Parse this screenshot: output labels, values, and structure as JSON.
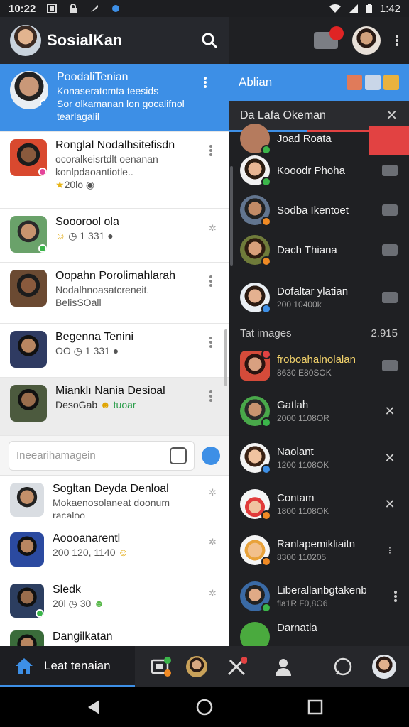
{
  "status": {
    "time": "10:22",
    "right_time": "1:42"
  },
  "appbar": {
    "title": "SosialKan"
  },
  "chats": [
    {
      "name": "PoodaliTenian",
      "lines": [
        "Konaseratomta teesids",
        "Sor olkamanan lon gocalifnol",
        "tearlagalil"
      ]
    },
    {
      "name": "Ronglal Nodalhsitefisdn",
      "lines": [
        "ocoralkeisrtdlt oenanan",
        "konlpdaoantiotle..",
        "20lo"
      ]
    },
    {
      "name": "Sooorool ola",
      "lines": [
        "1 331"
      ]
    },
    {
      "name": "Oopahn Porolimahlarah",
      "lines": [
        "Nodalhnoasatcreneit.",
        "BelisSOall"
      ]
    },
    {
      "name": "Begenna Tenini",
      "lines": [
        "OO",
        "1 331"
      ]
    },
    {
      "name": "Mianklı Nania Desioal",
      "lines": [
        "DesoGab",
        "tuoar"
      ]
    },
    {
      "name": "Sogltan Deyda Denloal",
      "lines": [
        "Mokaenosolaneat doonum",
        "racaloo"
      ]
    },
    {
      "name": "Aoooanarentl",
      "lines": [
        "200 120, 1140"
      ]
    },
    {
      "name": "Sledk",
      "lines": [
        "20l",
        "30"
      ]
    },
    {
      "name": "Dangilkatan",
      "lines": [
        ""
      ]
    }
  ],
  "search": {
    "placeholder": "Ineearihamagein"
  },
  "right": {
    "tab_title": "Ablian",
    "sub_title": "Da Lafa Okeman",
    "section": {
      "label": "Tat images",
      "count": "2.915"
    },
    "rows": [
      {
        "name": "Joad Roata",
        "sub": ""
      },
      {
        "name": "Kooodr Phoha",
        "sub": ""
      },
      {
        "name": "Sodba Ikentoet",
        "sub": ""
      },
      {
        "name": "Dach Thiana",
        "sub": ""
      },
      {
        "name": "Dofaltar ylatian",
        "sub": "200 10400k"
      },
      {
        "name": "froboahalnolalan",
        "sub": "8630 E80SOK"
      },
      {
        "name": "Gatlah",
        "sub": "2000 1108OR"
      },
      {
        "name": "Naolant",
        "sub": "1200 1108OK"
      },
      {
        "name": "Contam",
        "sub": "1800 1108OK"
      },
      {
        "name": "Ranlapemikliaitn",
        "sub": "8300 110205"
      },
      {
        "name": "Liberallanbgtakenb",
        "sub": "fla1R F0,8O6"
      },
      {
        "name": "Darnatla",
        "sub": ""
      }
    ]
  },
  "bottombar": {
    "active_label": "Leat tenaian"
  },
  "colors": {
    "accent": "#3d8fe6",
    "badge_red": "#e24242",
    "badge_green": "#3bb54a",
    "badge_orange": "#f08a24"
  }
}
